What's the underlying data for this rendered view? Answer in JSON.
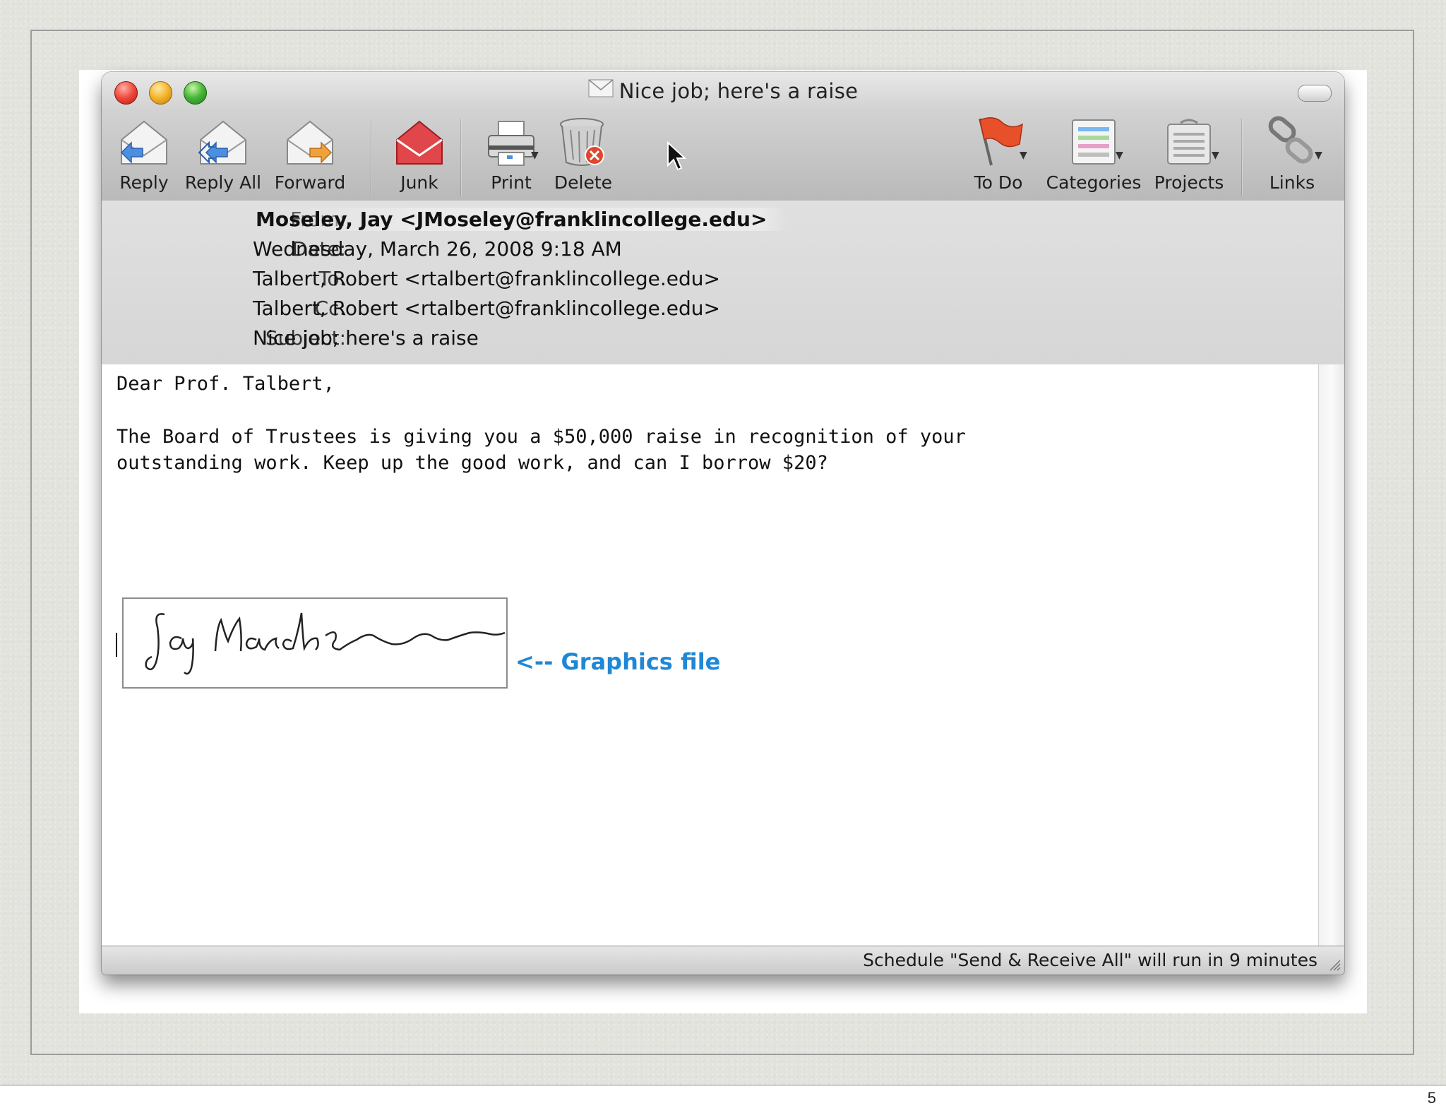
{
  "window": {
    "title": "Nice job; here's a raise"
  },
  "toolbar": {
    "reply": "Reply",
    "reply_all": "Reply All",
    "forward": "Forward",
    "junk": "Junk",
    "print": "Print",
    "delete": "Delete",
    "todo": "To Do",
    "categories": "Categories",
    "projects": "Projects",
    "links": "Links"
  },
  "headers": {
    "from_label": "From:",
    "from_value": "Moseley, Jay <JMoseley@franklincollege.edu>",
    "date_label": "Date:",
    "date_value": "Wednesday, March 26, 2008 9:18 AM",
    "to_label": "To:",
    "to_value": "Talbert, Robert <rtalbert@franklincollege.edu>",
    "cc_label": "Cc:",
    "cc_value": "Talbert, Robert <rtalbert@franklincollege.edu>",
    "subject_label": "Subject:",
    "subject_value": "Nice job; here's a raise"
  },
  "message": {
    "greeting": "Dear Prof. Talbert,",
    "line1": "The Board of Trustees is giving you a $50,000 raise in recognition of your",
    "line2": "outstanding work. Keep up the good work, and can I borrow $20?",
    "signature_text": "Jay Moseley"
  },
  "annotation": {
    "graphics_label": "<-- Graphics file"
  },
  "status": {
    "text": "Schedule \"Send & Receive All\" will run in 9 minutes"
  },
  "slide": {
    "number": "5"
  },
  "colors": {
    "annotation_blue": "#1f87d6",
    "close": "#f14b3e",
    "minimize": "#f6b52d",
    "zoom": "#48b73a"
  }
}
